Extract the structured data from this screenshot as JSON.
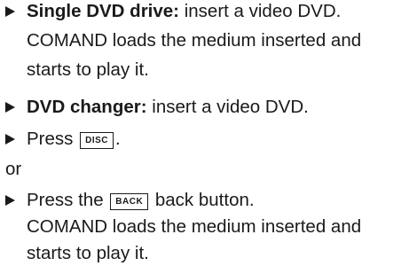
{
  "steps": {
    "single_dvd": {
      "label": "Single DVD drive:",
      "text": " insert a video DVD.",
      "line2": "COMAND loads the medium inserted and",
      "line3": "starts to play it."
    },
    "dvd_changer": {
      "label": "DVD changer:",
      "text": " insert a video DVD."
    },
    "press_disc": {
      "prefix": "Press ",
      "key": "DISC",
      "suffix": "."
    },
    "or_text": "or",
    "press_back": {
      "prefix": "Press the ",
      "key": "BACK",
      "suffix": " back button.",
      "line2": "COMAND loads the medium inserted and",
      "line3": "starts to play it."
    }
  }
}
